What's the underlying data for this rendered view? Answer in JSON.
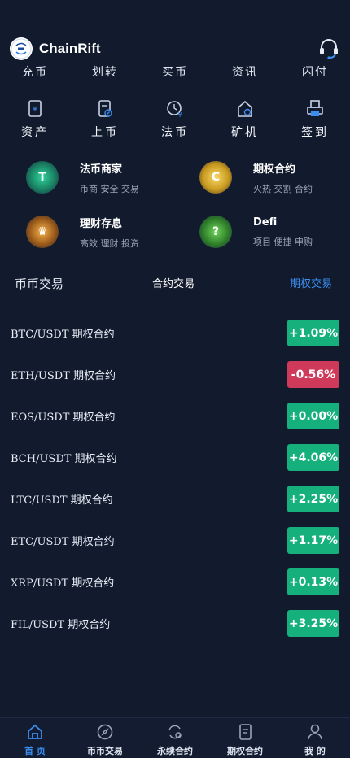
{
  "header": {
    "brand": "ChainRift",
    "logo_text": "ChainRift"
  },
  "quick_top": [
    "充币",
    "划转",
    "买币",
    "资讯",
    "闪付"
  ],
  "quick_grid": [
    {
      "label": "资产",
      "icon": "wallet-icon"
    },
    {
      "label": "上币",
      "icon": "document-edit-icon"
    },
    {
      "label": "法币",
      "icon": "clock-yen-icon"
    },
    {
      "label": "矿机",
      "icon": "mining-house-icon"
    },
    {
      "label": "签到",
      "icon": "printer-icon"
    }
  ],
  "services": [
    {
      "title": "法币商家",
      "subtitle": "币商 安全 交易",
      "icon": "tether-icon",
      "icon_glyph": "T",
      "color": "#2fd39a"
    },
    {
      "title": "期权合约",
      "subtitle": "火热 交割 合约",
      "icon": "gold-coin-icon",
      "icon_glyph": "C",
      "color": "#f0c431"
    },
    {
      "title": "理财存息",
      "subtitle": "高效 理财 投资",
      "icon": "crown-icon",
      "icon_glyph": "♛",
      "color": "#f0a23a"
    },
    {
      "title": "Defi",
      "subtitle": "项目 便捷 申购",
      "icon": "gift-box-icon",
      "icon_glyph": "?",
      "color": "#5dc84a"
    }
  ],
  "tabs": {
    "spot": "币币交易",
    "contract": "合约交易",
    "options": "期权交易",
    "active": "options"
  },
  "markets": [
    {
      "pair": "BTC/USDT 期权合约",
      "change": "+1.09%",
      "direction": "up"
    },
    {
      "pair": "ETH/USDT 期权合约",
      "change": "-0.56%",
      "direction": "down"
    },
    {
      "pair": "EOS/USDT 期权合约",
      "change": "+0.00%",
      "direction": "up"
    },
    {
      "pair": "BCH/USDT 期权合约",
      "change": "+4.06%",
      "direction": "up"
    },
    {
      "pair": "LTC/USDT 期权合约",
      "change": "+2.25%",
      "direction": "up"
    },
    {
      "pair": "ETC/USDT 期权合约",
      "change": "+1.17%",
      "direction": "up"
    },
    {
      "pair": "XRP/USDT 期权合约",
      "change": "+0.13%",
      "direction": "up"
    },
    {
      "pair": "FIL/USDT 期权合约",
      "change": "+3.25%",
      "direction": "up"
    }
  ],
  "bottom_nav": [
    {
      "label": "首 页",
      "icon": "home-icon",
      "active": true
    },
    {
      "label": "币币交易",
      "icon": "compass-icon",
      "active": false
    },
    {
      "label": "永续合约",
      "icon": "exchange-cycle-icon",
      "active": false
    },
    {
      "label": "期权合约",
      "icon": "document-icon",
      "active": false
    },
    {
      "label": "我 的",
      "icon": "user-icon",
      "active": false
    }
  ],
  "colors": {
    "background": "#121a2d",
    "accent": "#3a8ef0",
    "up": "#15b07c",
    "down": "#d03a5a"
  }
}
